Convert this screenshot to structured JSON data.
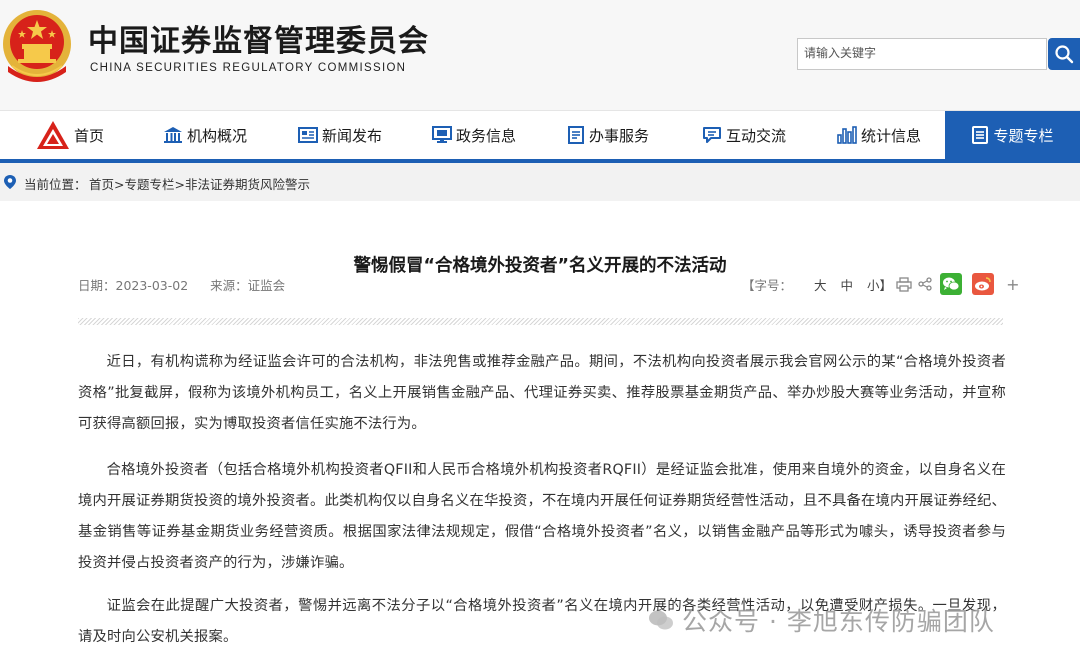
{
  "header": {
    "title_cn": "中国证券监督管理委员会",
    "title_en": "CHINA SECURITIES REGULATORY COMMISSION",
    "search_placeholder": "请输入关键字",
    "emblem_icon": "national-emblem-icon",
    "search_icon": "magnifier-icon"
  },
  "nav": {
    "items": [
      {
        "label": "首页",
        "icon": "logo-icon"
      },
      {
        "label": "机构概况",
        "icon": "building-icon"
      },
      {
        "label": "新闻发布",
        "icon": "newspaper-icon"
      },
      {
        "label": "政务信息",
        "icon": "monitor-icon"
      },
      {
        "label": "办事服务",
        "icon": "document-icon"
      },
      {
        "label": "互动交流",
        "icon": "chat-icon"
      },
      {
        "label": "统计信息",
        "icon": "bar-chart-icon"
      },
      {
        "label": "专题专栏",
        "icon": "special-icon"
      }
    ],
    "active_index": 7,
    "accent": "#1d5fb4"
  },
  "breadcrumb": {
    "label": "当前位置：",
    "items": [
      "首页",
      "专题专栏",
      "非法证券期货风险警示"
    ],
    "sep": ">"
  },
  "article": {
    "title": "警惕假冒“合格境外投资者”名义开展的不法活动",
    "date": "日期：2023-03-02",
    "source": "来源：证监会",
    "font_size_label": "【字号：",
    "size_large": "大",
    "size_medium": "中",
    "size_small": "小】",
    "share_plus": "+",
    "paragraphs": [
      "近日，有机构谎称为经证监会许可的合法机构，非法兜售或推荐金融产品。期间，不法机构向投资者展示我会官网公示的某“合格境外投资者资格”批复截屏，假称为该境外机构员工，名义上开展销售金融产品、代理证券买卖、推荐股票基金期货产品、举办炒股大赛等业务活动，并宣称可获得高额回报，实为博取投资者信任实施不法行为。",
      "合格境外投资者（包括合格境外机构投资者QFII和人民币合格境外机构投资者RQFII）是经证监会批准，使用来自境外的资金，以自身名义在境内开展证券期货投资的境外投资者。此类机构仅以自身名义在华投资，不在境内开展任何证券期货经营性活动，且不具备在境内开展证券经纪、基金销售等证券基金期货业务经营资质。根据国家法律法规规定，假借“合格境外投资者”名义，以销售金融产品等形式为噱头，诱导投资者参与投资并侵占投资者资产的行为，涉嫌诈骗。",
      "证监会在此提醒广大投资者，警惕并远离不法分子以“合格境外投资者”名义在境内开展的各类经营性活动，以免遭受财产损失。一旦发现，请及时向公安机关报案。"
    ]
  },
  "watermark": {
    "text": "公众号 · 李旭东传防骗团队"
  }
}
